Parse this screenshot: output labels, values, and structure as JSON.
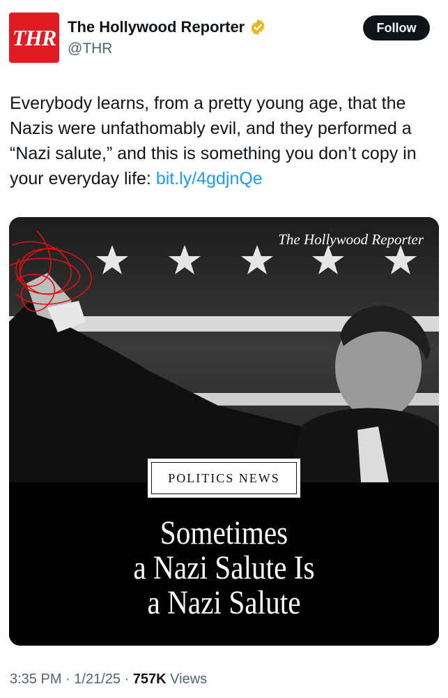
{
  "author": {
    "avatar_text": "THR",
    "display_name": "The Hollywood Reporter",
    "handle": "@THR",
    "verified_badge": "gold-check-icon"
  },
  "follow_label": "Follow",
  "tweet": {
    "text": "Everybody learns, from a pretty young age, that the Nazis were unfathomably evil, and they performed a “Nazi salute,” and this is something you don’t copy in your everyday life: ",
    "link": "bit.ly/4gdjnQe"
  },
  "media": {
    "logo": "The Hollywood Reporter",
    "category": "POLITICS NEWS",
    "headline_lines": [
      "Sometimes",
      "a Nazi Salute Is",
      "a Nazi Salute"
    ]
  },
  "meta": {
    "time": "3:35 PM",
    "date": "1/21/25",
    "views_count": "757K",
    "views_label": "Views"
  },
  "colors": {
    "link": "#1d9bf0",
    "brand_red": "#e01b22",
    "follow_bg": "#0f1419",
    "meta_gray": "#536471"
  }
}
